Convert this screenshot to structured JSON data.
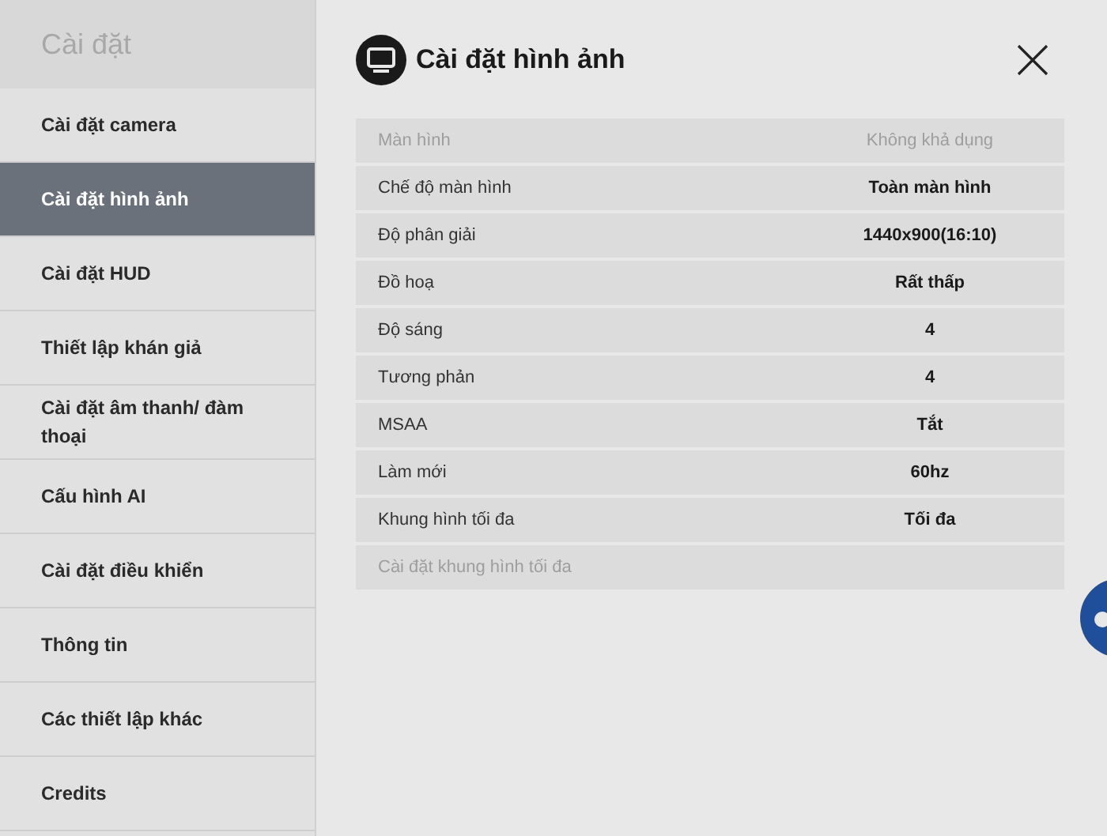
{
  "sidebar": {
    "title": "Cài đặt",
    "items": [
      {
        "label": "Cài đặt camera",
        "selected": false
      },
      {
        "label": "Cài đặt hình ảnh",
        "selected": true
      },
      {
        "label": "Cài đặt HUD",
        "selected": false
      },
      {
        "label": "Thiết lập khán giả",
        "selected": false
      },
      {
        "label": "Cài đặt âm thanh/ đàm thoại",
        "selected": false
      },
      {
        "label": "Cấu hình AI",
        "selected": false
      },
      {
        "label": "Cài đặt điều khiển",
        "selected": false
      },
      {
        "label": "Thông tin",
        "selected": false
      },
      {
        "label": "Các thiết lập khác",
        "selected": false
      },
      {
        "label": "Credits",
        "selected": false
      }
    ]
  },
  "panel": {
    "title": "Cài đặt hình ảnh",
    "rows": [
      {
        "label": "Màn hình",
        "value": "Không khả dụng",
        "disabled": true
      },
      {
        "label": "Chế độ màn hình",
        "value": "Toàn màn hình",
        "disabled": false
      },
      {
        "label": "Độ phân giải",
        "value": "1440x900(16:10)",
        "disabled": false
      },
      {
        "label": "Đồ hoạ",
        "value": "Rất thấp",
        "disabled": false
      },
      {
        "label": "Độ sáng",
        "value": "4",
        "disabled": false
      },
      {
        "label": "Tương phản",
        "value": "4",
        "disabled": false
      },
      {
        "label": "MSAA",
        "value": "Tắt",
        "disabled": false
      },
      {
        "label": "Làm mới",
        "value": "60hz",
        "disabled": false
      },
      {
        "label": "Khung hình tối đa",
        "value": "Tối đa",
        "disabled": false
      },
      {
        "label": "Cài đặt khung hình tối đa",
        "disabled": true
      }
    ]
  }
}
